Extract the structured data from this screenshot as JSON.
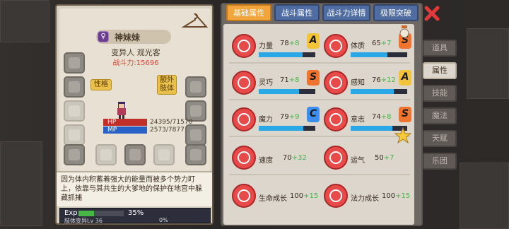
{
  "character": {
    "name": "神妹妹",
    "badge": "♀",
    "title": "变异人 观光客",
    "power": "战斗力:15696"
  },
  "tags": {
    "personality": "性格",
    "extra_body_1": "额外",
    "extra_body_2": "肢体"
  },
  "stats": {
    "hp_label": "HP",
    "hp_value": "24395/71570",
    "mp_label": "MP",
    "mp_value": "2573/7877"
  },
  "description": "因为体内积蓄着强大的能量而被多个势力盯上，依靠与其共生的大爹地的保护在地宫中躲藏抓捕",
  "exp": {
    "label": "Exp",
    "percent": "35%",
    "fill": 35,
    "sub_label": "肢体变异Lv 36",
    "sub_value": "0%"
  },
  "tabs": [
    "基础属性",
    "战斗属性",
    "战斗力详情",
    "极限突破"
  ],
  "active_tab": 0,
  "side_tabs": [
    "道具",
    "属性",
    "技能",
    "魔法",
    "天赋",
    "乐团"
  ],
  "active_side": 1,
  "attributes": [
    {
      "name": "力量",
      "base": "78",
      "bonus": "+8",
      "grade": "A",
      "grade_color": "#f3c43a",
      "fill": 0.78
    },
    {
      "name": "体质",
      "base": "65",
      "bonus": "+7",
      "grade": "S",
      "grade_color": "#f1742e",
      "fill": 0.65
    },
    {
      "name": "灵巧",
      "base": "71",
      "bonus": "+8",
      "grade": "S",
      "grade_color": "#f1742e",
      "fill": 0.71
    },
    {
      "name": "感知",
      "base": "76",
      "bonus": "+12",
      "grade": "A",
      "grade_color": "#f3c43a",
      "fill": 0.76
    },
    {
      "name": "魔力",
      "base": "79",
      "bonus": "+9",
      "grade": "C",
      "grade_color": "#3c8ff0",
      "fill": 0.79
    },
    {
      "name": "意志",
      "base": "74",
      "bonus": "+8",
      "grade": "S",
      "grade_color": "#f1742e",
      "fill": 0.74
    },
    {
      "name": "速度",
      "base": "70",
      "bonus": "+32"
    },
    {
      "name": "运气",
      "base": "50",
      "bonus": "+7"
    },
    {
      "name": "生命成长",
      "base": "100",
      "bonus": "+15"
    },
    {
      "name": "法力成长",
      "base": "100",
      "bonus": "+15"
    }
  ]
}
